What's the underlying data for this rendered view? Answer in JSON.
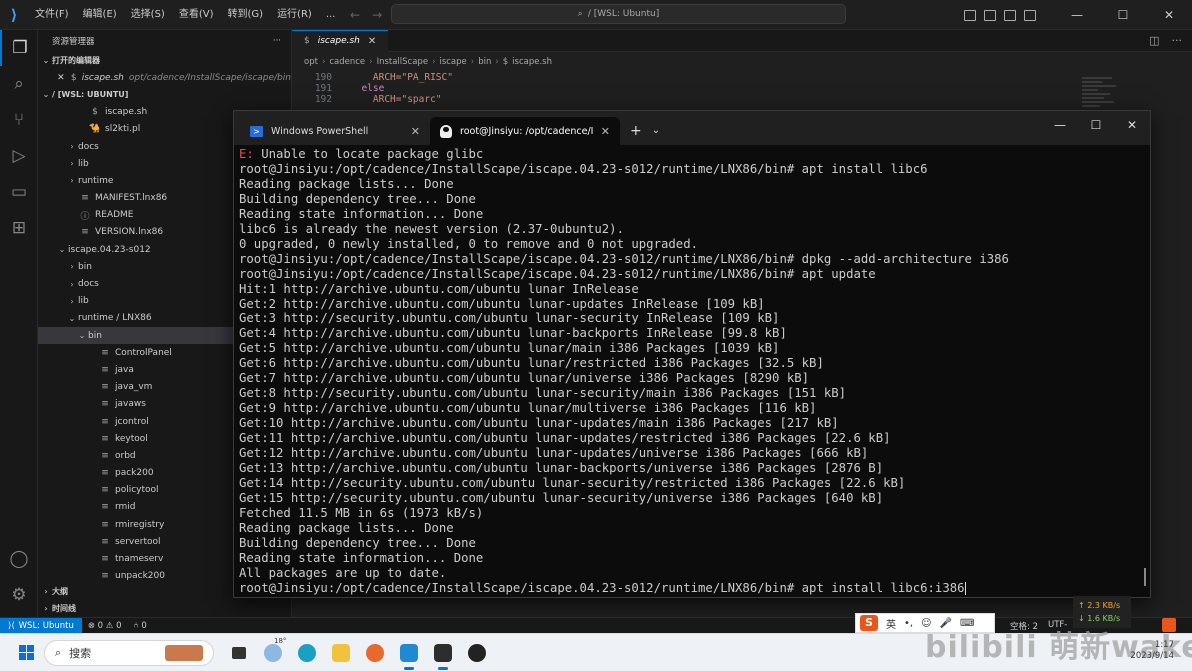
{
  "titlebar": {
    "menu": [
      "文件(F)",
      "编辑(E)",
      "选择(S)",
      "查看(V)",
      "转到(G)",
      "运行(R)",
      "..."
    ],
    "command_center": "/ [WSL: Ubuntu]"
  },
  "sidebar": {
    "title": "资源管理器",
    "more": "···",
    "open_editors_label": "打开的编辑器",
    "open_file": "iscape.sh",
    "open_file_path": "opt/cadence/InstallScape/iscape/bin",
    "root_label": "/ [WSL: UBUNTU]",
    "items": [
      {
        "label": "iscape.sh",
        "icon": "$",
        "depth": 3,
        "twisty": ""
      },
      {
        "label": "sl2kti.pl",
        "icon": "🐪",
        "depth": 3,
        "twisty": ""
      },
      {
        "label": "docs",
        "icon": "",
        "depth": 2,
        "twisty": "›"
      },
      {
        "label": "lib",
        "icon": "",
        "depth": 2,
        "twisty": "›"
      },
      {
        "label": "runtime",
        "icon": "",
        "depth": 2,
        "twisty": "›"
      },
      {
        "label": "MANIFEST.lnx86",
        "icon": "≡",
        "depth": 2,
        "twisty": ""
      },
      {
        "label": "README",
        "icon": "ⓘ",
        "depth": 2,
        "twisty": ""
      },
      {
        "label": "VERSION.lnx86",
        "icon": "≡",
        "depth": 2,
        "twisty": ""
      },
      {
        "label": "iscape.04.23-s012",
        "icon": "",
        "depth": 1,
        "twisty": "⌄"
      },
      {
        "label": "bin",
        "icon": "",
        "depth": 2,
        "twisty": "›"
      },
      {
        "label": "docs",
        "icon": "",
        "depth": 2,
        "twisty": "›"
      },
      {
        "label": "lib",
        "icon": "",
        "depth": 2,
        "twisty": "›"
      },
      {
        "label": "runtime / LNX86",
        "icon": "",
        "depth": 2,
        "twisty": "⌄"
      },
      {
        "label": "bin",
        "icon": "",
        "depth": 3,
        "twisty": "⌄",
        "selected": true
      },
      {
        "label": "ControlPanel",
        "icon": "≡",
        "depth": 4,
        "twisty": ""
      },
      {
        "label": "java",
        "icon": "≡",
        "depth": 4,
        "twisty": ""
      },
      {
        "label": "java_vm",
        "icon": "≡",
        "depth": 4,
        "twisty": ""
      },
      {
        "label": "javaws",
        "icon": "≡",
        "depth": 4,
        "twisty": ""
      },
      {
        "label": "jcontrol",
        "icon": "≡",
        "depth": 4,
        "twisty": ""
      },
      {
        "label": "keytool",
        "icon": "≡",
        "depth": 4,
        "twisty": ""
      },
      {
        "label": "orbd",
        "icon": "≡",
        "depth": 4,
        "twisty": ""
      },
      {
        "label": "pack200",
        "icon": "≡",
        "depth": 4,
        "twisty": ""
      },
      {
        "label": "policytool",
        "icon": "≡",
        "depth": 4,
        "twisty": ""
      },
      {
        "label": "rmid",
        "icon": "≡",
        "depth": 4,
        "twisty": ""
      },
      {
        "label": "rmiregistry",
        "icon": "≡",
        "depth": 4,
        "twisty": ""
      },
      {
        "label": "servertool",
        "icon": "≡",
        "depth": 4,
        "twisty": ""
      },
      {
        "label": "tnameserv",
        "icon": "≡",
        "depth": 4,
        "twisty": ""
      },
      {
        "label": "unpack200",
        "icon": "≡",
        "depth": 4,
        "twisty": ""
      }
    ],
    "outline_label": "大纲",
    "timeline_label": "时间线"
  },
  "editor": {
    "tab_label": "iscape.sh",
    "tab_icon": "$",
    "breadcrumbs": [
      "opt",
      "cadence",
      "InstallScape",
      "iscape",
      "bin",
      "iscape.sh"
    ],
    "lines": [
      {
        "num": "190",
        "text": "    ARCH=\"PA_RISC\""
      },
      {
        "num": "191",
        "text": "  else"
      },
      {
        "num": "192",
        "text": "    ARCH=\"sparc\""
      }
    ]
  },
  "terminal": {
    "tabs": [
      {
        "label": "Windows PowerShell",
        "icon": "powershell-icon"
      },
      {
        "label": "root@Jinsiyu: /opt/cadence/I",
        "icon": "tux-icon"
      }
    ],
    "error_prefix": "E:",
    "lines": [
      " Unable to locate package glibc",
      "root@Jinsiyu:/opt/cadence/InstallScape/iscape.04.23-s012/runtime/LNX86/bin# apt install libc6",
      "Reading package lists... Done",
      "Building dependency tree... Done",
      "Reading state information... Done",
      "libc6 is already the newest version (2.37-0ubuntu2).",
      "0 upgraded, 0 newly installed, 0 to remove and 0 not upgraded.",
      "root@Jinsiyu:/opt/cadence/InstallScape/iscape.04.23-s012/runtime/LNX86/bin# dpkg --add-architecture i386",
      "root@Jinsiyu:/opt/cadence/InstallScape/iscape.04.23-s012/runtime/LNX86/bin# apt update",
      "Hit:1 http://archive.ubuntu.com/ubuntu lunar InRelease",
      "Get:2 http://archive.ubuntu.com/ubuntu lunar-updates InRelease [109 kB]",
      "Get:3 http://security.ubuntu.com/ubuntu lunar-security InRelease [109 kB]",
      "Get:4 http://archive.ubuntu.com/ubuntu lunar-backports InRelease [99.8 kB]",
      "Get:5 http://archive.ubuntu.com/ubuntu lunar/main i386 Packages [1039 kB]",
      "Get:6 http://archive.ubuntu.com/ubuntu lunar/restricted i386 Packages [32.5 kB]",
      "Get:7 http://archive.ubuntu.com/ubuntu lunar/universe i386 Packages [8290 kB]",
      "Get:8 http://security.ubuntu.com/ubuntu lunar-security/main i386 Packages [151 kB]",
      "Get:9 http://archive.ubuntu.com/ubuntu lunar/multiverse i386 Packages [116 kB]",
      "Get:10 http://archive.ubuntu.com/ubuntu lunar-updates/main i386 Packages [217 kB]",
      "Get:11 http://archive.ubuntu.com/ubuntu lunar-updates/restricted i386 Packages [22.6 kB]",
      "Get:12 http://archive.ubuntu.com/ubuntu lunar-updates/universe i386 Packages [666 kB]",
      "Get:13 http://archive.ubuntu.com/ubuntu lunar-backports/universe i386 Packages [2876 B]",
      "Get:14 http://security.ubuntu.com/ubuntu lunar-security/restricted i386 Packages [22.6 kB]",
      "Get:15 http://security.ubuntu.com/ubuntu lunar-security/universe i386 Packages [640 kB]",
      "Fetched 11.5 MB in 6s (1973 kB/s)",
      "Reading package lists... Done",
      "Building dependency tree... Done",
      "Reading state information... Done",
      "All packages are up to date.",
      "root@Jinsiyu:/opt/cadence/InstallScape/iscape.04.23-s012/runtime/LNX86/bin# apt install libc6:i386"
    ]
  },
  "statusbar": {
    "remote": "WSL: Ubuntu",
    "problems": "⊗ 0 ⚠ 0",
    "ports": "⑃ 0",
    "right": [
      "空格: 2",
      "UTF-"
    ]
  },
  "netspeed": {
    "up": "↑ 2.3 KB/s",
    "down": "↓ 1.6 KB/s"
  },
  "taskbar": {
    "search_placeholder": "搜索",
    "weather": "18°",
    "ime_label": "英",
    "watermark": "bilibili 萌新wake",
    "clock_time": "1:17",
    "clock_date": "2023/9/14"
  },
  "colors": {
    "accent": "#0078d4",
    "error": "#e74856",
    "terminal_bg": "#0c0c0c"
  }
}
